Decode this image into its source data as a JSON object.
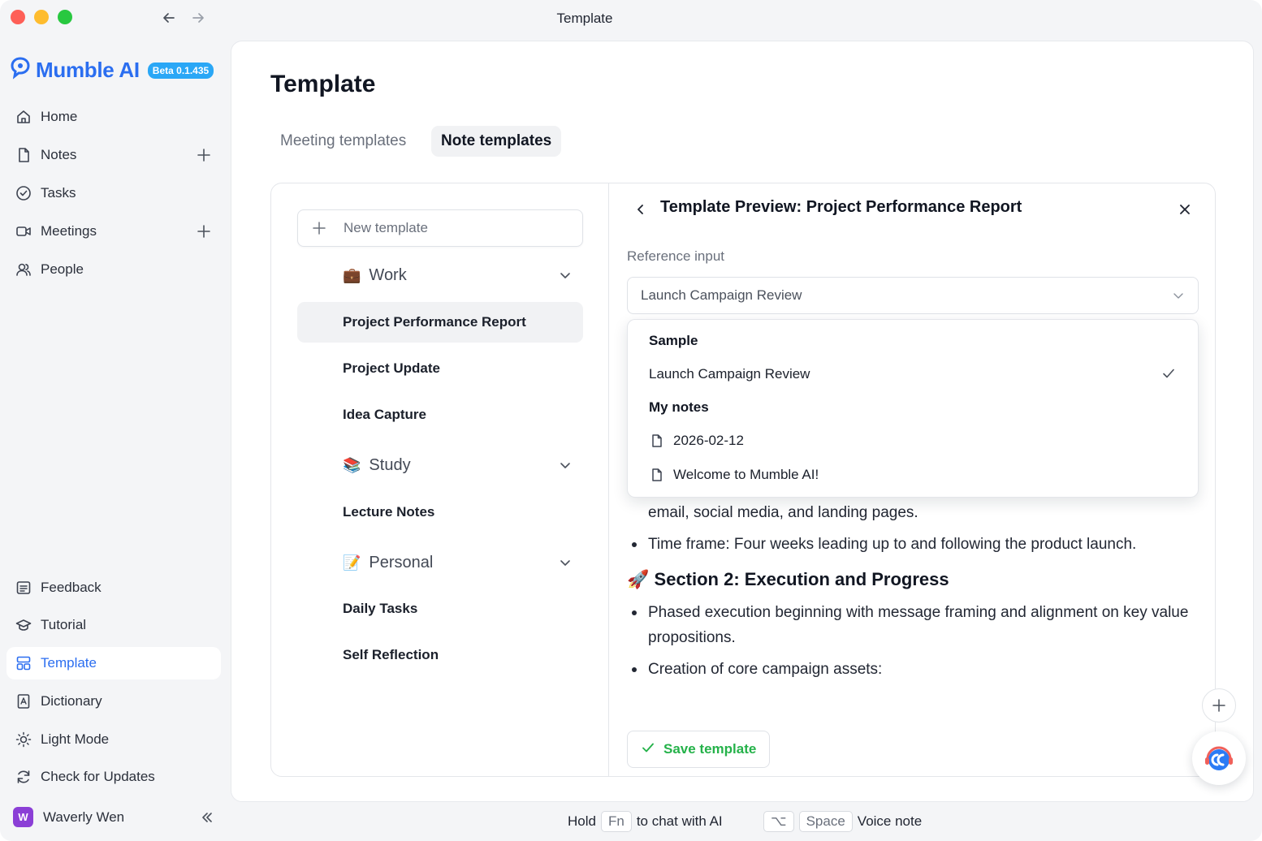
{
  "window": {
    "title": "Template"
  },
  "brand": {
    "name": "Mumble AI",
    "version": "Beta 0.1.435"
  },
  "sidebar": {
    "top_items": [
      {
        "label": "Home",
        "icon": "home-icon"
      },
      {
        "label": "Notes",
        "icon": "note-icon",
        "has_add": true
      },
      {
        "label": "Tasks",
        "icon": "check-circle-icon"
      },
      {
        "label": "Meetings",
        "icon": "video-icon",
        "has_add": true
      },
      {
        "label": "People",
        "icon": "people-icon"
      }
    ],
    "bottom_items": [
      {
        "label": "Feedback",
        "icon": "feedback-icon"
      },
      {
        "label": "Tutorial",
        "icon": "graduation-cap-icon"
      },
      {
        "label": "Template",
        "icon": "template-icon",
        "active": true
      },
      {
        "label": "Dictionary",
        "icon": "dictionary-icon"
      },
      {
        "label": "Light Mode",
        "icon": "sun-icon"
      },
      {
        "label": "Check for Updates",
        "icon": "refresh-icon"
      }
    ],
    "user": {
      "initial": "W",
      "name": "Waverly Wen"
    }
  },
  "main": {
    "title": "Template",
    "tabs": [
      {
        "label": "Meeting templates",
        "active": false
      },
      {
        "label": "Note templates",
        "active": true
      }
    ],
    "new_template_label": "New template",
    "groups": [
      {
        "emoji": "💼",
        "name": "Work",
        "items": [
          "Project Performance Report",
          "Project Update",
          "Idea Capture"
        ]
      },
      {
        "emoji": "📚",
        "name": "Study",
        "items": [
          "Lecture Notes"
        ]
      },
      {
        "emoji": "📝",
        "name": "Personal",
        "items": [
          "Daily Tasks",
          "Self Reflection"
        ]
      }
    ],
    "selected_item": "Project Performance Report"
  },
  "preview": {
    "title": "Template Preview: Project Performance Report",
    "reference_label": "Reference input",
    "reference_value": "Launch Campaign Review",
    "dropdown": {
      "sample_heading": "Sample",
      "sample_option": "Launch Campaign Review",
      "mynotes_heading": "My notes",
      "note_options": [
        "2026-02-12",
        "Welcome to Mumble AI!"
      ]
    },
    "content": {
      "line_continuation": "email, social media, and landing pages.",
      "bullet_timeframe": "Time frame: Four weeks leading up to and following the product launch.",
      "section2_emoji": "🚀",
      "section2_title": "Section 2: Execution and Progress",
      "bullet_phased": "Phased execution beginning with message framing and alignment on key value propositions.",
      "bullet_creation": "Creation of core campaign assets:"
    },
    "save_label": "Save template"
  },
  "footer": {
    "hold": "Hold",
    "fn_key": "Fn",
    "chat_text": "to chat with AI",
    "option_key": "⌥",
    "space_key": "Space",
    "voice_text": "Voice note"
  },
  "colors": {
    "accent": "#2b6ef0",
    "success": "#25b24a",
    "beta_badge": "#2aa7f6"
  }
}
